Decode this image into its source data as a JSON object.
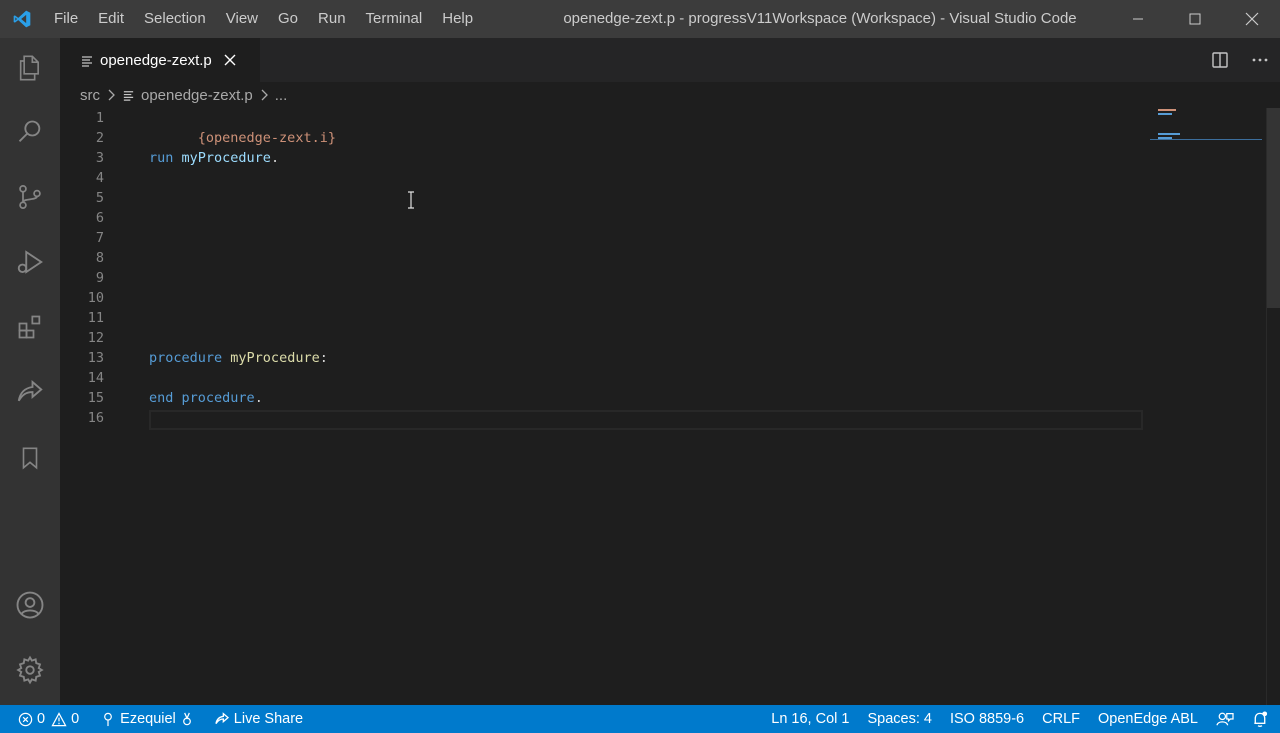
{
  "window": {
    "title": "openedge-zext.p - progressV11Workspace (Workspace) - Visual Studio Code"
  },
  "menu": [
    "File",
    "Edit",
    "Selection",
    "View",
    "Go",
    "Run",
    "Terminal",
    "Help"
  ],
  "activity_bar": [
    "explorer-icon",
    "search-icon",
    "source-control-icon",
    "run-debug-icon",
    "extensions-icon",
    "live-share-icon",
    "bookmarks-icon",
    "accounts-icon",
    "settings-gear-icon"
  ],
  "tab": {
    "label": "openedge-zext.p"
  },
  "breadcrumb": {
    "folder": "src",
    "file": "openedge-zext.p",
    "more": "..."
  },
  "editor": {
    "line_numbers": [
      "1",
      "2",
      "3",
      "4",
      "5",
      "6",
      "7",
      "8",
      "9",
      "10",
      "11",
      "12",
      "13",
      "14",
      "15",
      "16"
    ],
    "lines": {
      "l1": "{openedge-zext.i}",
      "l3_kw": "run",
      "l3_id": "myProcedure",
      "l3_end": ".",
      "l13_kw": "procedure",
      "l13_fn": "myProcedure",
      "l13_end": ":",
      "l15_kw1": "end",
      "l15_kw2": "procedure",
      "l15_end": "."
    }
  },
  "statusbar": {
    "errors": "0",
    "warnings": "0",
    "user": "Ezequiel",
    "live_share": "Live Share",
    "position": "Ln 16, Col 1",
    "indent": "Spaces: 4",
    "encoding": "ISO 8859-6",
    "eol": "CRLF",
    "language": "OpenEdge ABL"
  },
  "colors": {
    "statusbar": "#007acc",
    "activitybar": "#333333",
    "editor_bg": "#1e1e1e",
    "keyword": "#569cd6",
    "function": "#dcdcaa",
    "variable": "#9cdcfe",
    "string": "#ce9178"
  }
}
